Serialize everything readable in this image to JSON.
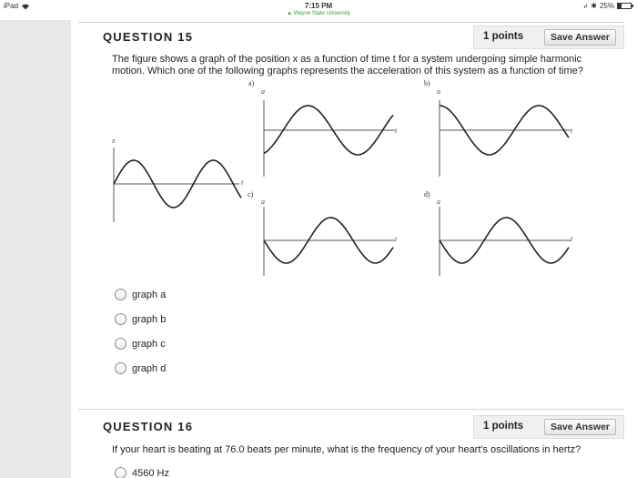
{
  "status_bar": {
    "device": "iPad",
    "time": "7:15 PM",
    "url": "Wayne State University",
    "battery": "25%",
    "battery_level": 0.25
  },
  "questions": [
    {
      "title": "QUESTION 15",
      "points": "1 points",
      "save_label": "Save Answer",
      "text": "The figure shows a graph of the position x as a function of time t for a system undergoing simple harmonic motion. Which one of the following graphs represents the acceleration of this system as a function of time?",
      "figure": {
        "main": {
          "y_label": "x",
          "t_label": "t"
        },
        "graphs": [
          {
            "label": "a)",
            "y_label": "a",
            "t_label": "t"
          },
          {
            "label": "b)",
            "y_label": "a",
            "t_label": "t"
          },
          {
            "label": "c)",
            "y_label": "a",
            "t_label": "t"
          },
          {
            "label": "d)",
            "y_label": "a",
            "t_label": "t"
          }
        ]
      },
      "options": [
        "graph a",
        "graph b",
        "graph c",
        "graph d"
      ]
    },
    {
      "title": "QUESTION 16",
      "points": "1 points",
      "save_label": "Save Answer",
      "text": "If your heart is beating at 76.0 beats per minute, what is the frequency of your heart's oscillations in hertz?",
      "options": [
        "4560 Hz"
      ]
    }
  ]
}
